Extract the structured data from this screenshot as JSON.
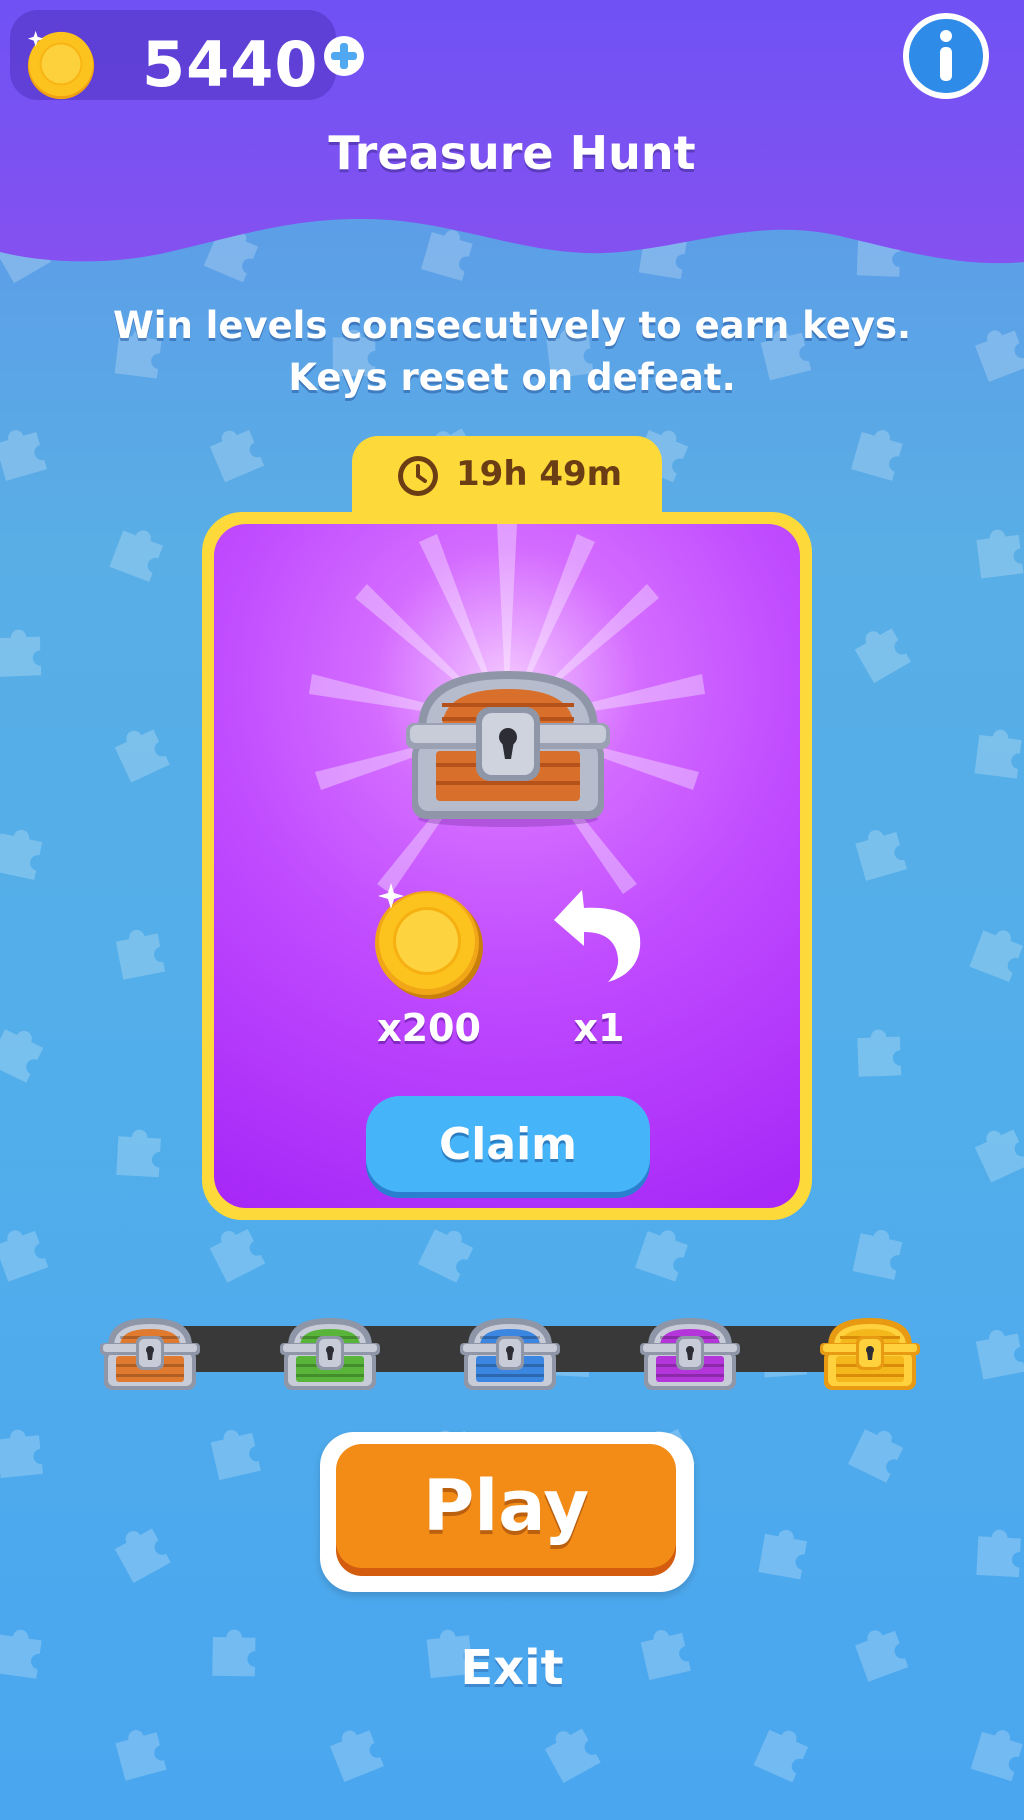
{
  "header": {
    "coin_balance": "5440",
    "title": "Treasure Hunt",
    "add_coins_icon": "plus-icon",
    "info_icon": "info-icon"
  },
  "description": {
    "line1": "Win levels consecutively to earn keys.",
    "line2": "Keys reset on defeat."
  },
  "event": {
    "time_remaining": "19h 49m",
    "clock_icon": "clock-icon"
  },
  "reward": {
    "chest_icon": "silver-chest-icon",
    "items": [
      {
        "icon": "coin-icon",
        "label": "x200"
      },
      {
        "icon": "undo-icon",
        "label": "x1"
      }
    ],
    "claim_label": "Claim"
  },
  "progress": {
    "chests": [
      {
        "name": "orange-chest",
        "color": "#e07a2e"
      },
      {
        "name": "green-chest",
        "color": "#58b53a"
      },
      {
        "name": "blue-chest",
        "color": "#3a86e0"
      },
      {
        "name": "purple-chest",
        "color": "#b435d9"
      },
      {
        "name": "gold-chest",
        "color": "#f5b81c"
      }
    ]
  },
  "actions": {
    "play_label": "Play",
    "exit_label": "Exit"
  },
  "colors": {
    "header_purple": "#7a4ef5",
    "card_yellow": "#fdd93a",
    "card_purple": "#c04cff",
    "claim_blue": "#46b4f8",
    "play_orange": "#f28c17"
  }
}
